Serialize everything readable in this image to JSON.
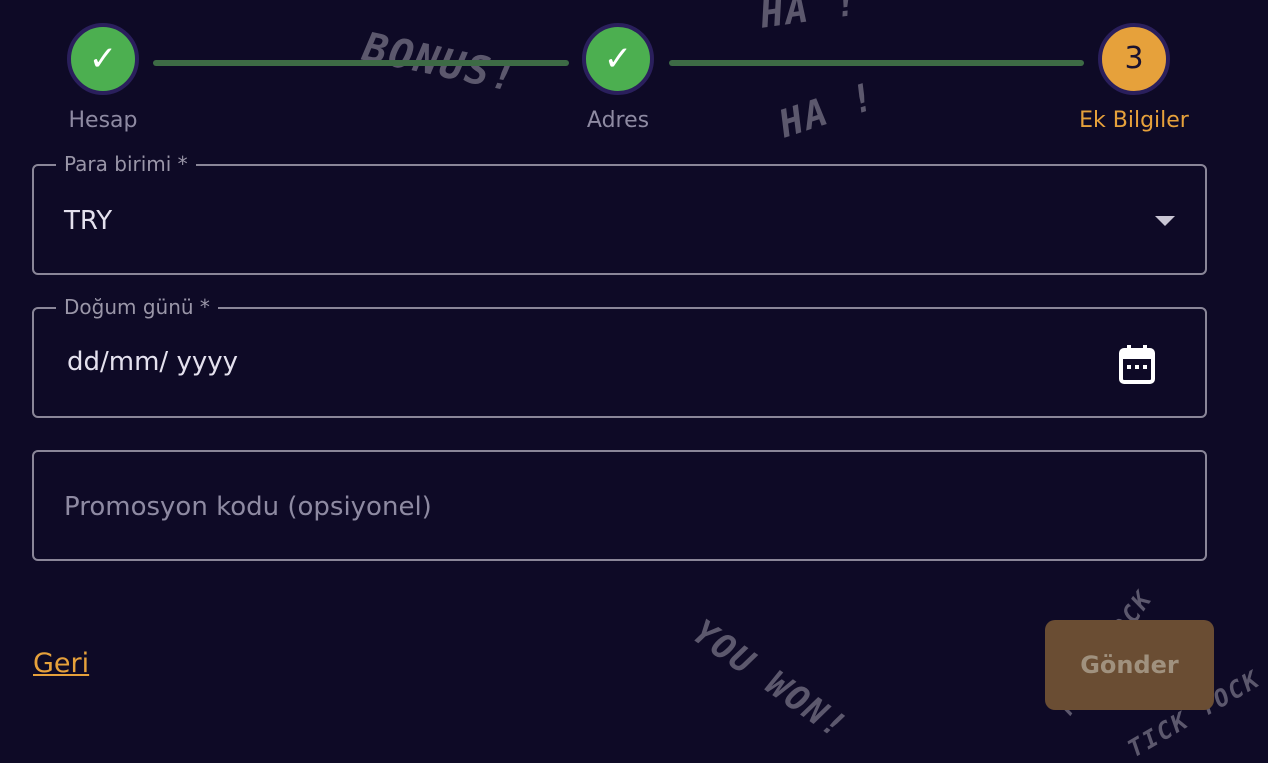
{
  "stepper": {
    "steps": [
      {
        "label": "Hesap",
        "state": "done"
      },
      {
        "label": "Adres",
        "state": "done"
      },
      {
        "label": "Ek Bilgiler",
        "state": "active",
        "number": "3"
      }
    ]
  },
  "form": {
    "currency": {
      "label": "Para birimi *",
      "value": "TRY"
    },
    "birthday": {
      "label": "Doğum günü *",
      "placeholder": "dd/mm/ yyyy"
    },
    "promo": {
      "placeholder": "Promosyon kodu (opsiyonel)"
    }
  },
  "actions": {
    "back_label": "Geri",
    "submit_label": "Gönder"
  },
  "decorations": {
    "ha_top": "HA !",
    "bonus": "BONUS!",
    "ha_mid": "HA !",
    "you_won": "YOU WON!",
    "tick_tock_1": "TICK TOCK",
    "tick_tock_2": "TICK TOCK"
  },
  "colors": {
    "background": "#0e0a26",
    "done": "#4caf50",
    "active": "#e6a13b",
    "connector": "#3d6b45",
    "submit_bg": "#6a4d33"
  }
}
